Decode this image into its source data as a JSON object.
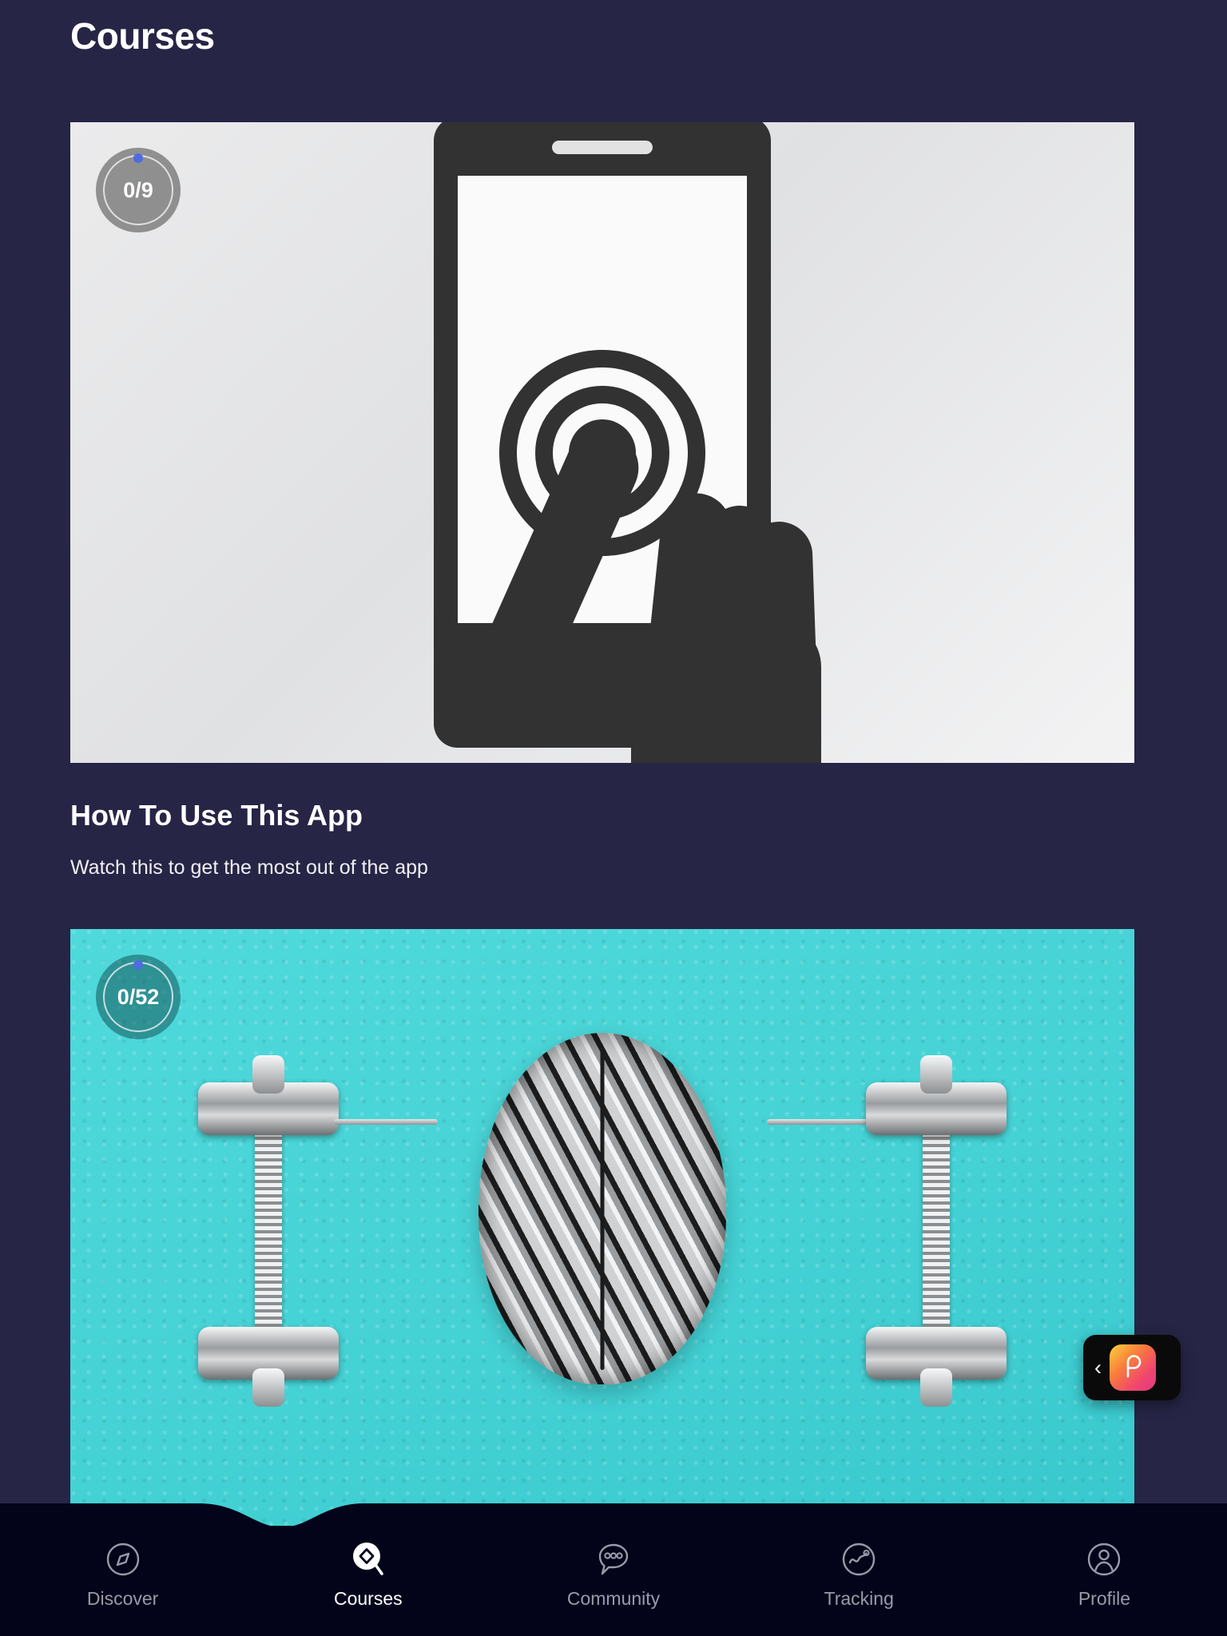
{
  "header": {
    "title": "Courses"
  },
  "theme": {
    "background": "#262546",
    "nav_background": "#03041a",
    "accent_dot": "#4f6ce0",
    "teal_card": "#4fd9db",
    "gray_card": "#e3e4e6",
    "active_label": "#ffffff",
    "inactive_label": "#9a9aa8"
  },
  "courses": [
    {
      "progress_label": "0/9",
      "progress_current": 0,
      "progress_total": 9,
      "title": "How To Use This App",
      "subtitle": "Watch this to get the most out of the app",
      "thumbnail": "phone-tap-illustration"
    },
    {
      "progress_label": "0/52",
      "progress_current": 0,
      "progress_total": 52,
      "title": "",
      "subtitle": "",
      "thumbnail": "brain-dumbbells-photo"
    }
  ],
  "floating_widget": {
    "collapse_icon": "chevron-left-icon",
    "collapse_glyph": "‹",
    "app_icon": "heart-p-app-icon"
  },
  "bottom_nav": {
    "items": [
      {
        "label": "Discover",
        "icon": "compass-icon",
        "active": false
      },
      {
        "label": "Courses",
        "icon": "gem-search-icon",
        "active": true
      },
      {
        "label": "Community",
        "icon": "chat-bubble-icon",
        "active": false
      },
      {
        "label": "Tracking",
        "icon": "activity-chart-icon",
        "active": false
      },
      {
        "label": "Profile",
        "icon": "person-icon",
        "active": false
      }
    ]
  }
}
